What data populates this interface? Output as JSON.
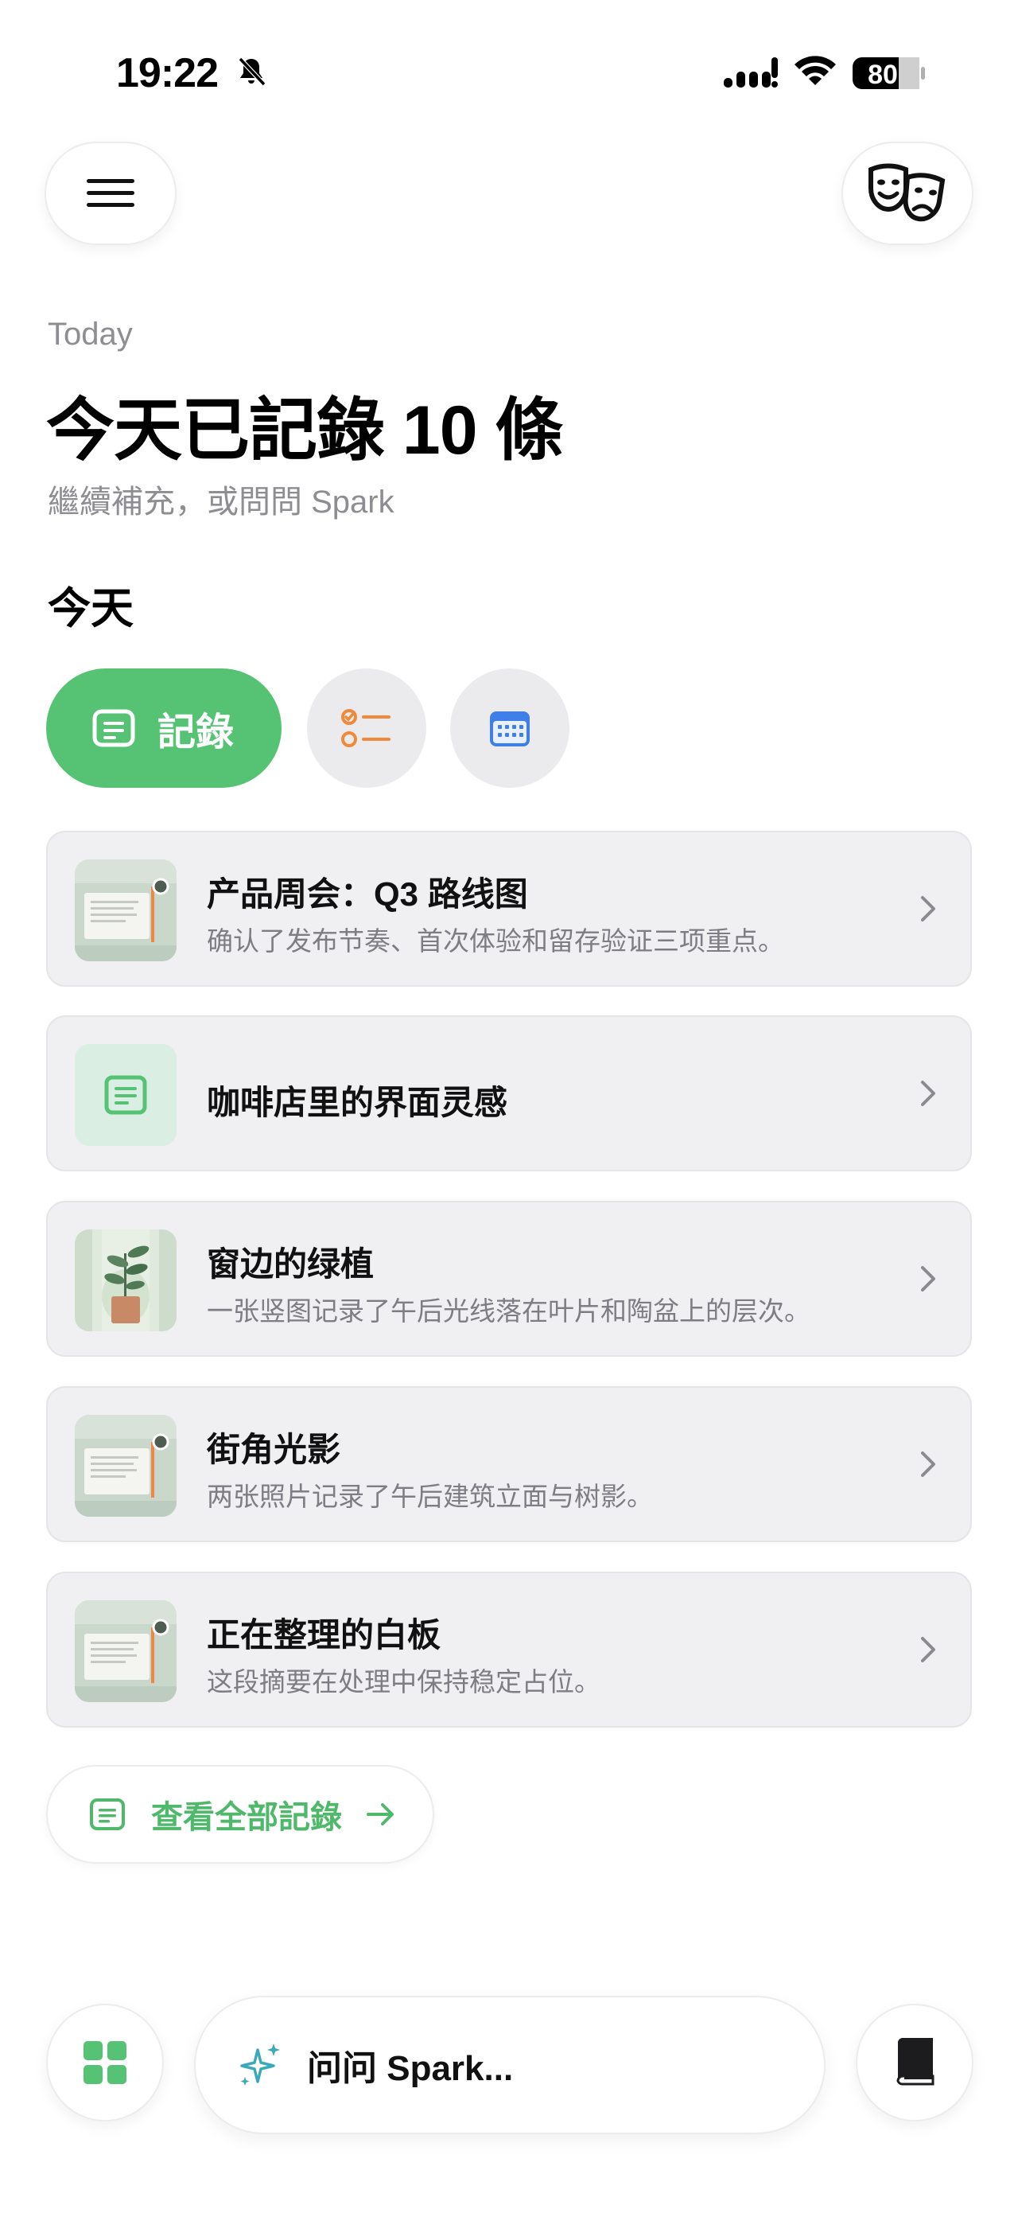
{
  "status_bar": {
    "time": "19:22",
    "battery_percent": "80",
    "icons": [
      "bell-slash-icon",
      "signal-icon",
      "wifi-icon",
      "battery-icon"
    ]
  },
  "top_bar": {
    "left_icon": "menu-icon",
    "right_icon": "theater-masks-icon"
  },
  "header": {
    "eyebrow": "Today",
    "title": "今天已記錄 10 條",
    "subtitle": "繼續補充，或問問 Spark"
  },
  "section": {
    "title": "今天"
  },
  "filters": {
    "primary_label": "記錄",
    "primary_icon": "note-icon",
    "todo_icon": "checklist-icon",
    "calendar_icon": "calendar-icon"
  },
  "records": [
    {
      "title": "产品周会：Q3 路线图",
      "desc": "确认了发布节奏、首次体验和留存验证三项重点。",
      "thumb": "whiteboard"
    },
    {
      "title": "咖啡店里的界面灵感",
      "desc": "",
      "thumb": "note"
    },
    {
      "title": "窗边的绿植",
      "desc": "一张竖图记录了午后光线落在叶片和陶盆上的层次。",
      "thumb": "plant"
    },
    {
      "title": "街角光影",
      "desc": "两张照片记录了午后建筑立面与树影。",
      "thumb": "whiteboard"
    },
    {
      "title": "正在整理的白板",
      "desc": "这段摘要在处理中保持稳定占位。",
      "thumb": "whiteboard"
    }
  ],
  "view_all": {
    "label": "查看全部記錄"
  },
  "bottom_bar": {
    "ask_placeholder": "问问 Spark...",
    "left_icon": "apps-grid-icon",
    "right_icon": "book-icon",
    "ask_icon": "sparkle-icon"
  },
  "colors": {
    "accent_green": "#55c274",
    "text_green": "#4fb86b",
    "orange": "#f08a3a",
    "blue": "#3f7fe8",
    "card_bg": "#f0f0f3",
    "muted_text": "#8d8d92"
  }
}
